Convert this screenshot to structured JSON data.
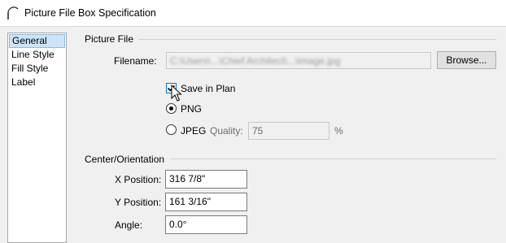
{
  "window": {
    "title": "Picture File Box Specification"
  },
  "nav": {
    "items": [
      "General",
      "Line Style",
      "Fill Style",
      "Label"
    ],
    "selected": "General"
  },
  "picture_file": {
    "section_title": "Picture File",
    "filename_label": "Filename:",
    "filename_value": "C:\\Users\\...\\Chief Architect\\...\\image.jpg",
    "browse_label": "Browse...",
    "save_in_plan_label": "Save in Plan",
    "save_in_plan_checked": true,
    "png_label": "PNG",
    "jpeg_label": "JPEG",
    "format_selected": "PNG",
    "quality_label": "Quality:",
    "quality_value": "75",
    "percent_label": "%"
  },
  "center_orientation": {
    "section_title": "Center/Orientation",
    "x_label": "X Position:",
    "x_value": "316 7/8\"",
    "y_label": "Y Position:",
    "y_value": "161 3/16\"",
    "angle_label": "Angle:",
    "angle_value": "0.0°"
  },
  "colors": {
    "accent": "#0078d7",
    "selection": "#cce4f7"
  }
}
